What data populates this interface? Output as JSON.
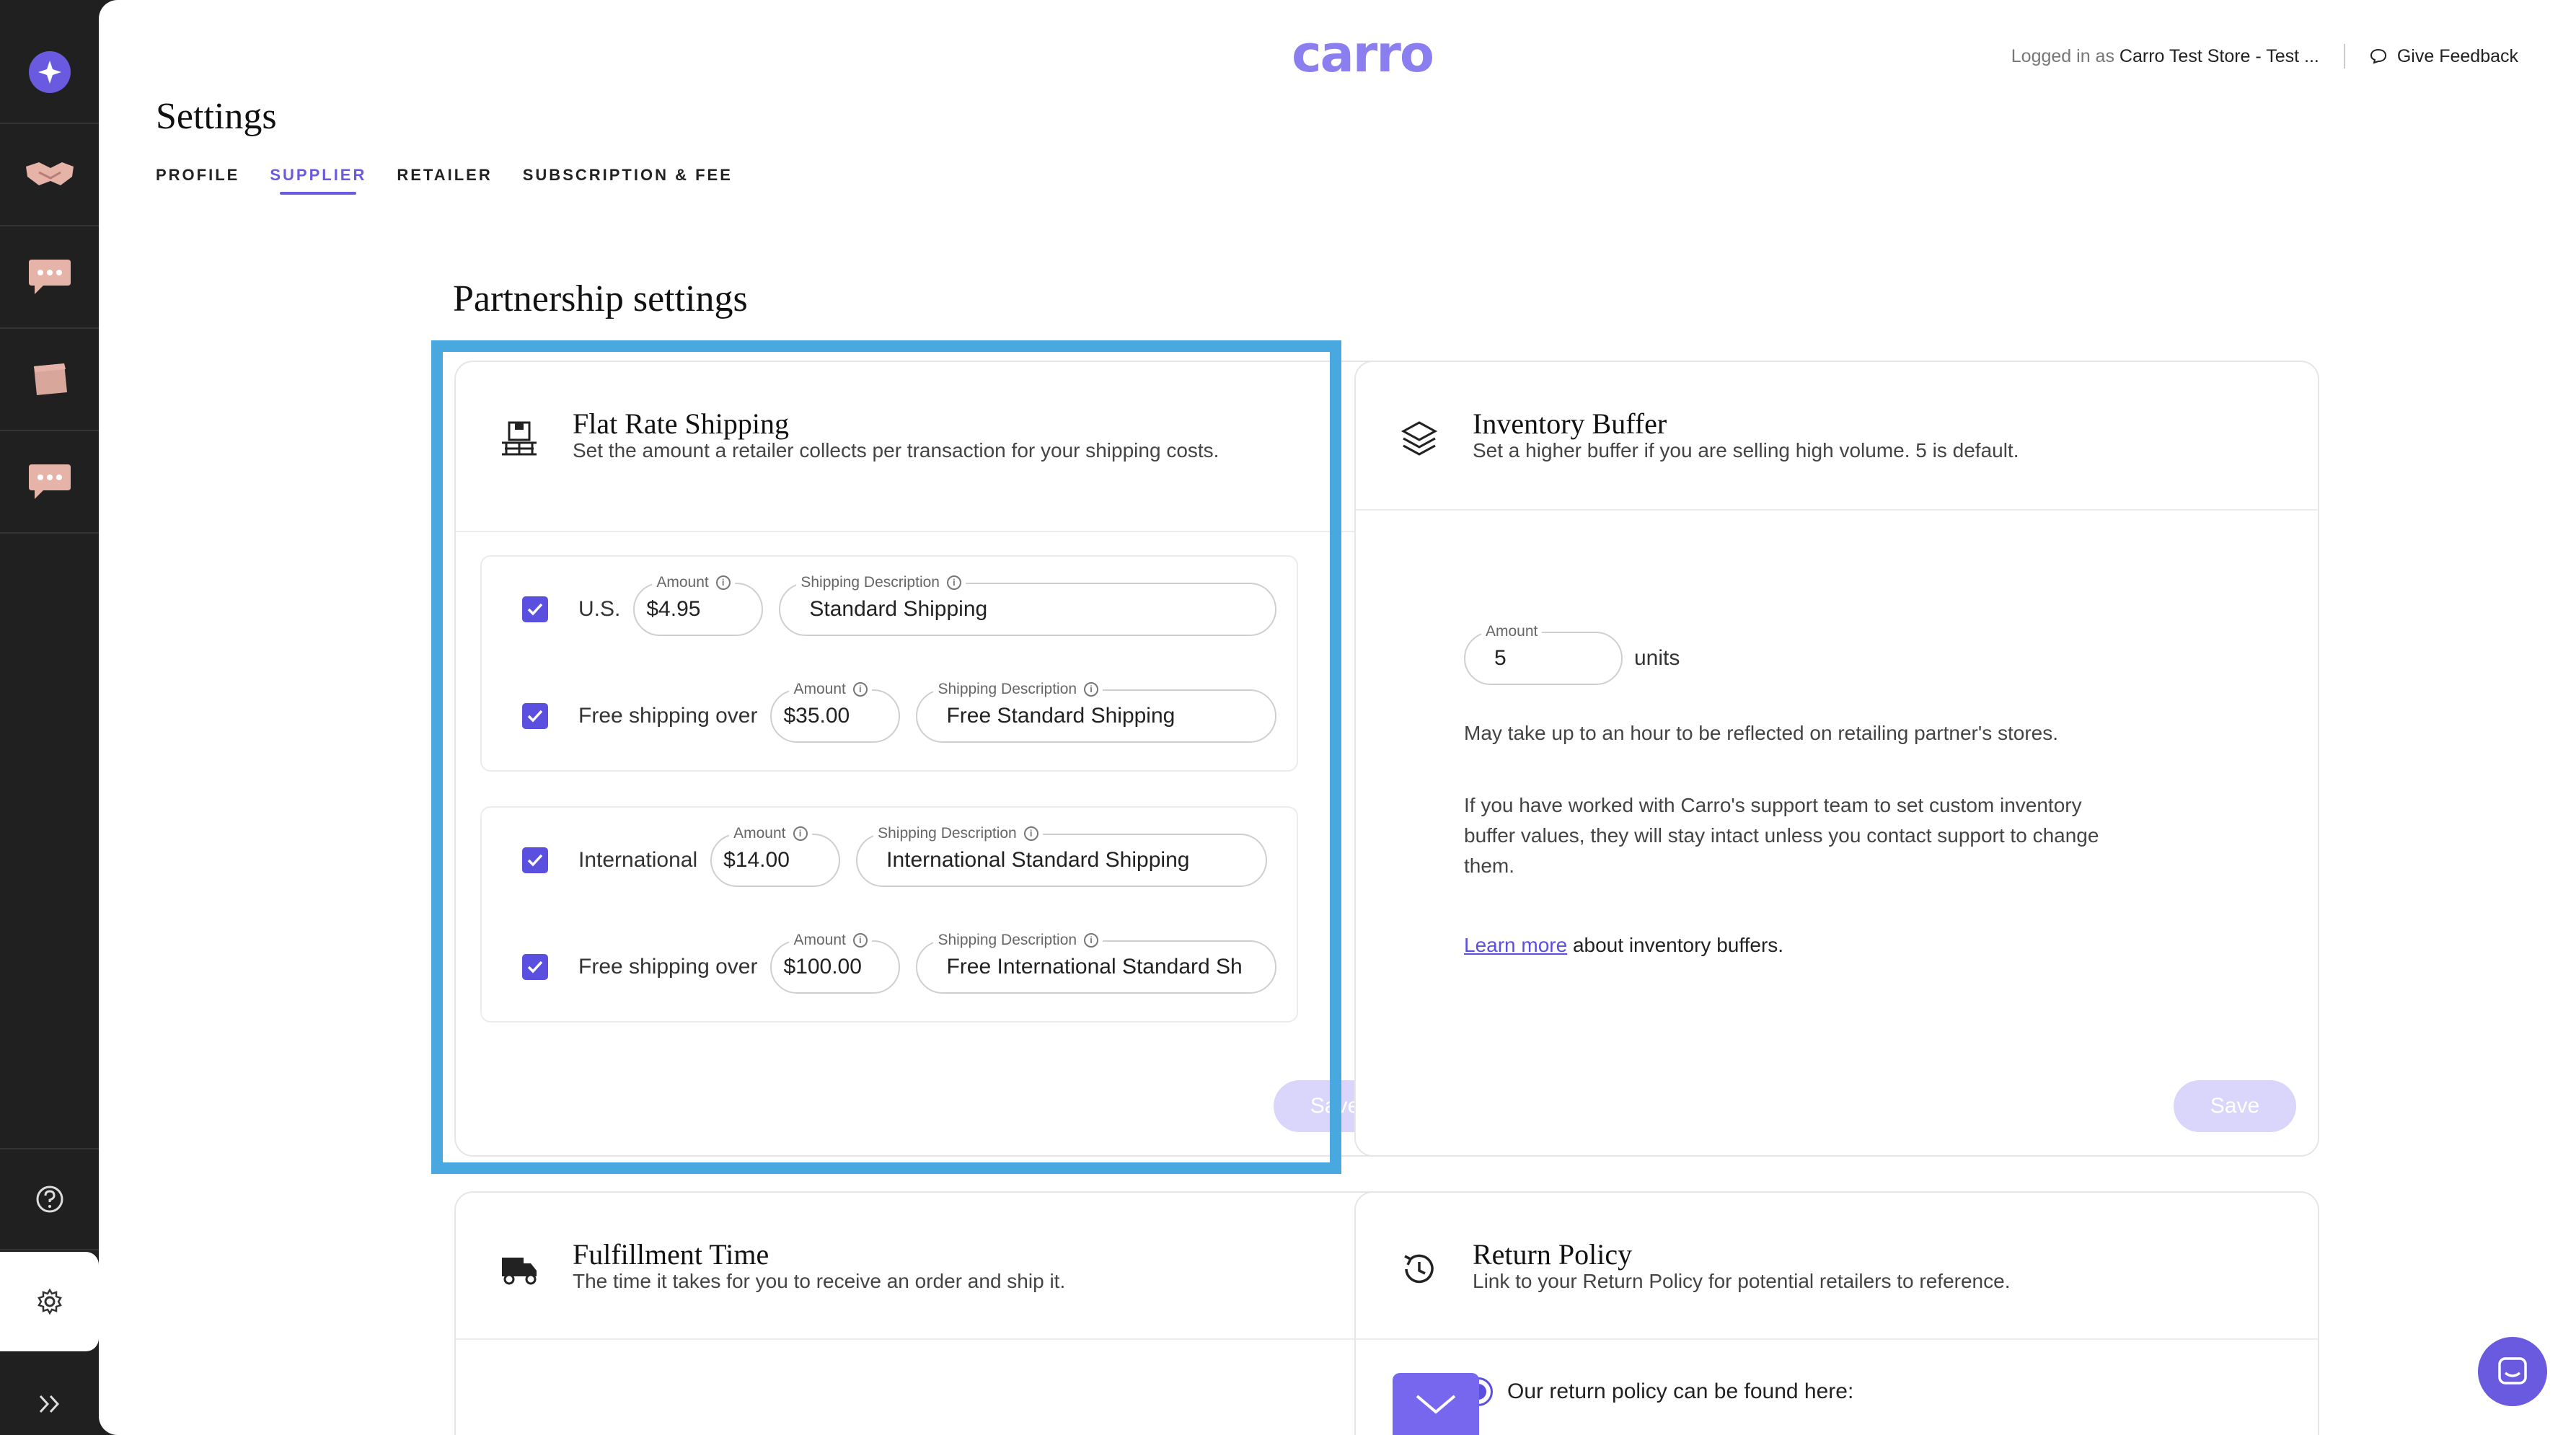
{
  "header": {
    "logo": "carro",
    "logged_in_prefix": "Logged in as ",
    "logged_in_store": "Carro Test Store - Test ...",
    "feedback_label": "Give Feedback"
  },
  "page": {
    "title": "Settings",
    "tabs": [
      {
        "label": "PROFILE"
      },
      {
        "label": "SUPPLIER"
      },
      {
        "label": "RETAILER"
      },
      {
        "label": "SUBSCRIPTION & FEE"
      }
    ],
    "active_tab": "SUPPLIER",
    "section_title": "Partnership settings"
  },
  "flat_rate": {
    "title": "Flat Rate Shipping",
    "subtitle": "Set the amount a retailer collects per transaction for your shipping costs.",
    "amount_label": "Amount",
    "desc_label": "Shipping Description",
    "rows": [
      {
        "label": "U.S.",
        "amount": "$4.95",
        "description": "Standard Shipping",
        "checked": true
      },
      {
        "label": "Free shipping over",
        "amount": "$35.00",
        "description": "Free Standard Shipping",
        "checked": true
      },
      {
        "label": "International",
        "amount": "$14.00",
        "description": "International Standard Shipping",
        "checked": true
      },
      {
        "label": "Free shipping over",
        "amount": "$100.00",
        "description": "Free International Standard Sh",
        "checked": true
      }
    ],
    "save_label": "Save"
  },
  "inventory": {
    "title": "Inventory Buffer",
    "subtitle": "Set a higher buffer if you are selling high volume. 5 is default.",
    "amount_label": "Amount",
    "amount_value": "5",
    "units": "units",
    "note1": "May take up to an hour to be reflected on retailing partner's stores.",
    "note2": "If you have worked with Carro's support team to set custom inventory buffer values, they will stay intact unless you contact support to change them.",
    "learn_more": "Learn more",
    "learn_more_suffix": " about inventory buffers.",
    "save_label": "Save"
  },
  "fulfillment": {
    "title": "Fulfillment Time",
    "subtitle": "The time it takes for you to receive an order and ship it."
  },
  "return_policy": {
    "title": "Return Policy",
    "subtitle": "Link to your Return Policy for potential retailers to reference.",
    "option_label": "Our return policy can be found here:"
  },
  "colors": {
    "accent": "#6a5ae0",
    "highlight": "#4aa8e0",
    "sidebar": "#202020",
    "save_disabled": "#d9d5fb"
  }
}
